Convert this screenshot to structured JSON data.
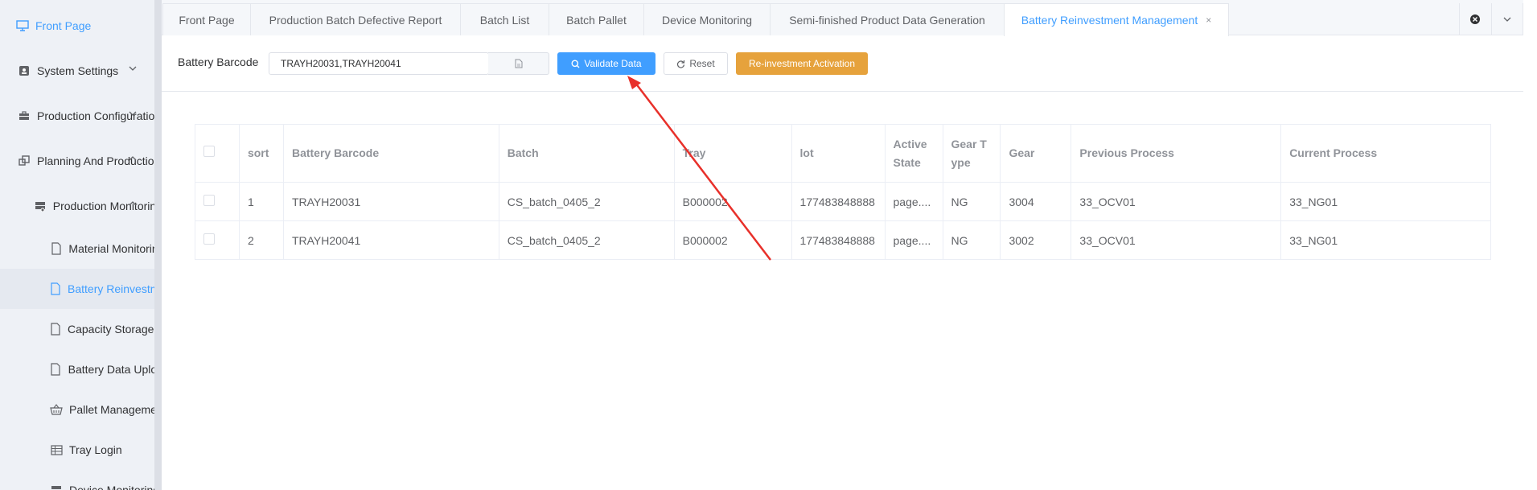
{
  "sidebar": {
    "items": [
      {
        "label": "Front Page",
        "icon": "monitor-icon"
      },
      {
        "label": "System Settings",
        "icon": "lock-icon"
      },
      {
        "label": "Production Configuration",
        "icon": "briefcase-icon"
      },
      {
        "label": "Planning And Production",
        "icon": "copy-icon"
      },
      {
        "label": "Production Monitoring",
        "icon": "server-icon"
      },
      {
        "label": "Material Monitoring",
        "icon": "document-icon"
      },
      {
        "label": "Battery Reinvestment",
        "icon": "document-icon"
      },
      {
        "label": "Capacity Storage Loc",
        "icon": "document-icon"
      },
      {
        "label": "Battery Data Upload",
        "icon": "document-icon"
      },
      {
        "label": "Pallet Management",
        "icon": "basket-icon"
      },
      {
        "label": "Tray Login",
        "icon": "grid-icon"
      },
      {
        "label": "Device Monitoring",
        "icon": "server-icon"
      }
    ]
  },
  "tabs": [
    {
      "label": "Front Page"
    },
    {
      "label": "Production Batch Defective Report"
    },
    {
      "label": "Batch List"
    },
    {
      "label": "Batch Pallet"
    },
    {
      "label": "Device Monitoring"
    },
    {
      "label": "Semi-finished Product Data Generation"
    },
    {
      "label": "Battery Reinvestment Management",
      "close": "×"
    }
  ],
  "toolbar": {
    "barcode_label": "Battery Barcode",
    "barcode_value": "TRAYH20031,TRAYH20041",
    "validate_label": "Validate Data",
    "reset_label": "Reset",
    "activate_label": "Re-investment Activation"
  },
  "table": {
    "headers": [
      "sort",
      "Battery Barcode",
      "Batch",
      "Tray",
      "lot",
      "Active State",
      "Gear T ype",
      "Gear",
      "Previous Process",
      "Current Process"
    ],
    "rows": [
      [
        "1",
        "TRAYH20031",
        "CS_batch_0405_2",
        "B000002",
        "177483848888",
        "page....",
        "NG",
        "3004",
        "33_OCV01",
        "33_NG01"
      ],
      [
        "2",
        "TRAYH20041",
        "CS_batch_0405_2",
        "B000002",
        "177483848888",
        "page....",
        "NG",
        "3002",
        "33_OCV01",
        "33_NG01"
      ]
    ]
  },
  "colors": {
    "primary": "#409eff",
    "warning": "#e6a23c",
    "annotation_arrow": "#e8302a"
  }
}
